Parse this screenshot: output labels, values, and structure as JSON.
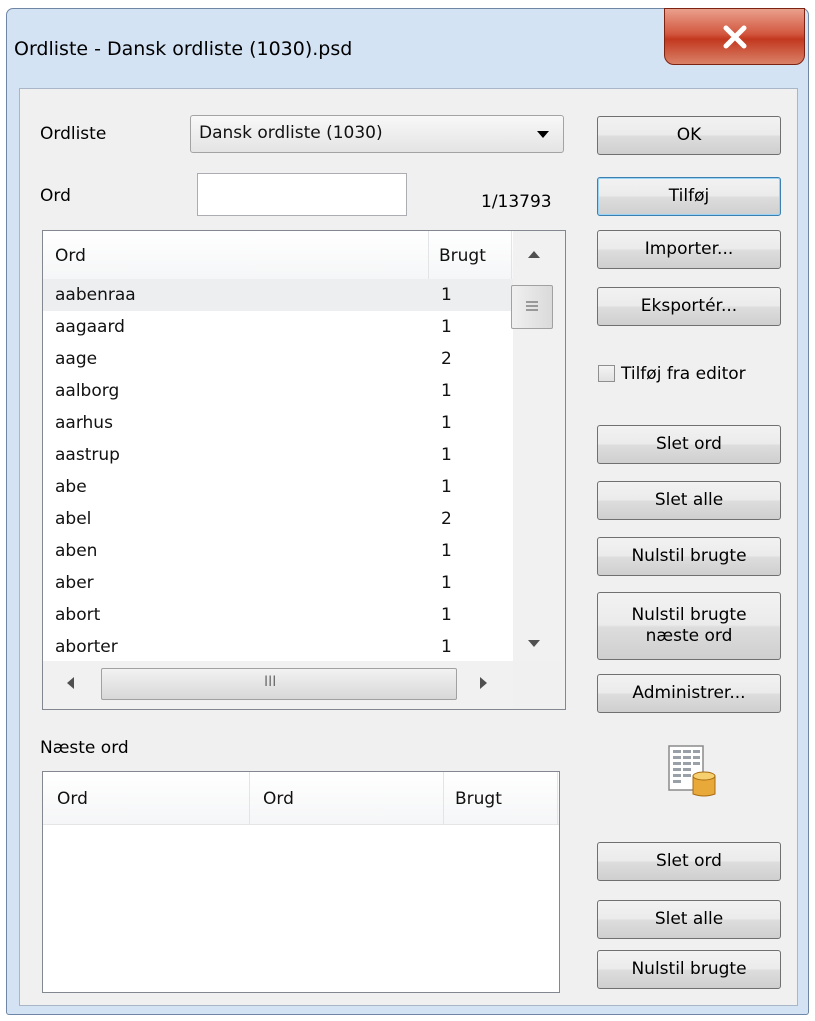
{
  "window": {
    "title": "Ordliste - Dansk ordliste (1030).psd",
    "close_icon": "close-icon"
  },
  "form": {
    "ordliste_label": "Ordliste",
    "ordliste_value": "Dansk ordliste (1030)",
    "ord_label": "Ord",
    "ord_value": "",
    "count": "1/13793"
  },
  "wordlist": {
    "headers": [
      "Ord",
      "Brugt"
    ],
    "rows": [
      {
        "word": "aabenraa",
        "used": "1"
      },
      {
        "word": "aagaard",
        "used": "1"
      },
      {
        "word": "aage",
        "used": "2"
      },
      {
        "word": "aalborg",
        "used": "1"
      },
      {
        "word": "aarhus",
        "used": "1"
      },
      {
        "word": "aastrup",
        "used": "1"
      },
      {
        "word": "abe",
        "used": "1"
      },
      {
        "word": "abel",
        "used": "2"
      },
      {
        "word": "aben",
        "used": "1"
      },
      {
        "word": "aber",
        "used": "1"
      },
      {
        "word": "abort",
        "used": "1"
      },
      {
        "word": "aborter",
        "used": "1"
      }
    ],
    "hscroll_thumb": "III"
  },
  "next_words": {
    "label": "Næste ord",
    "headers": [
      "Ord",
      "Ord",
      "Brugt"
    ]
  },
  "buttons": {
    "ok": "OK",
    "add": "Tilføj",
    "import": "Importer...",
    "export": "Eksportér...",
    "add_from_editor": "Tilføj fra editor",
    "delete_word": "Slet ord",
    "delete_all": "Slet alle",
    "reset_used": "Nulstil brugte",
    "reset_used_next_1": "Nulstil brugte",
    "reset_used_next_2": "næste ord",
    "manage": "Administrer...",
    "delete_word_2": "Slet ord",
    "delete_all_2": "Slet alle",
    "reset_used_2": "Nulstil brugte"
  },
  "colors": {
    "frame": "#d4e3f4",
    "close": "#c2381f",
    "client": "#f0f0f0"
  }
}
